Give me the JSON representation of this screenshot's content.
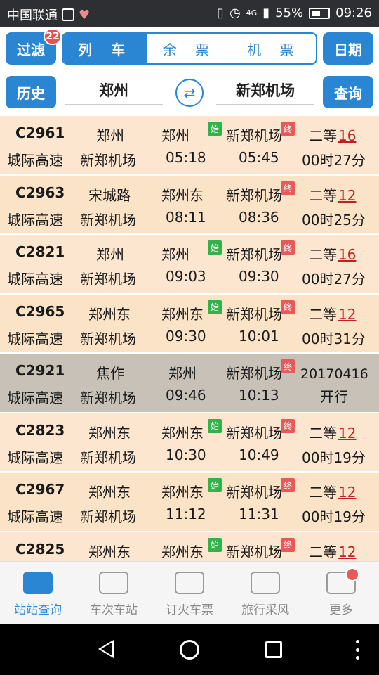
{
  "status": {
    "carrier": "中国联通",
    "network": "4G",
    "battery": "55%",
    "time": "09:26"
  },
  "toolbar": {
    "filter_label": "过滤",
    "filter_badge": "22",
    "tabs": [
      {
        "label": "列 车",
        "active": true
      },
      {
        "label": "余 票",
        "active": false
      },
      {
        "label": "机 票",
        "active": false
      }
    ],
    "date_label": "日期",
    "history_label": "历史",
    "from_station": "郑州",
    "to_station": "新郑机场",
    "query_label": "查询"
  },
  "trains": [
    {
      "code": "C2961",
      "type": "城际高速",
      "from": "郑州",
      "to": "新郑机场",
      "dep_station": "郑州",
      "dep_time": "05:18",
      "arr_station": "新郑机场",
      "arr_time": "05:45",
      "seat_class": "二等",
      "seat_count": "16",
      "duration": "00时27分",
      "start_tag": "始",
      "end_tag": "终"
    },
    {
      "code": "C2963",
      "type": "城际高速",
      "from": "宋城路",
      "to": "新郑机场",
      "dep_station": "郑州东",
      "dep_time": "08:11",
      "arr_station": "新郑机场",
      "arr_time": "08:36",
      "seat_class": "二等",
      "seat_count": "12",
      "duration": "00时25分",
      "start_tag": "",
      "end_tag": "终"
    },
    {
      "code": "C2821",
      "type": "城际高速",
      "from": "郑州",
      "to": "新郑机场",
      "dep_station": "郑州",
      "dep_time": "09:03",
      "arr_station": "新郑机场",
      "arr_time": "09:30",
      "seat_class": "二等",
      "seat_count": "16",
      "duration": "00时27分",
      "start_tag": "始",
      "end_tag": "终"
    },
    {
      "code": "C2965",
      "type": "城际高速",
      "from": "郑州东",
      "to": "新郑机场",
      "dep_station": "郑州东",
      "dep_time": "09:30",
      "arr_station": "新郑机场",
      "arr_time": "10:01",
      "seat_class": "二等",
      "seat_count": "12",
      "duration": "00时31分",
      "start_tag": "始",
      "end_tag": "终"
    },
    {
      "code": "C2921",
      "type": "城际高速",
      "from": "焦作",
      "to": "新郑机场",
      "dep_station": "郑州",
      "dep_time": "09:46",
      "arr_station": "新郑机场",
      "arr_time": "10:13",
      "notice_date": "20170416",
      "notice_text": "开行",
      "start_tag": "",
      "end_tag": "终"
    },
    {
      "code": "C2823",
      "type": "城际高速",
      "from": "郑州东",
      "to": "新郑机场",
      "dep_station": "郑州东",
      "dep_time": "10:30",
      "arr_station": "新郑机场",
      "arr_time": "10:49",
      "seat_class": "二等",
      "seat_count": "12",
      "duration": "00时19分",
      "start_tag": "始",
      "end_tag": "终"
    },
    {
      "code": "C2967",
      "type": "城际高速",
      "from": "郑州东",
      "to": "新郑机场",
      "dep_station": "郑州东",
      "dep_time": "11:12",
      "arr_station": "新郑机场",
      "arr_time": "11:31",
      "seat_class": "二等",
      "seat_count": "12",
      "duration": "00时19分",
      "start_tag": "始",
      "end_tag": "终"
    },
    {
      "code": "C2825",
      "type": "",
      "from": "郑州东",
      "to": "",
      "dep_station": "郑州东",
      "dep_time": "",
      "arr_station": "新郑机场",
      "arr_time": "",
      "seat_class": "二等",
      "seat_count": "12",
      "duration": "",
      "start_tag": "始",
      "end_tag": "终"
    }
  ],
  "bottom_nav": [
    {
      "label": "站站查询",
      "icon": "train-icon",
      "active": true
    },
    {
      "label": "车次车站",
      "icon": "briefcase-icon",
      "active": false
    },
    {
      "label": "订火车票",
      "icon": "ticket-icon",
      "active": false
    },
    {
      "label": "旅行采风",
      "icon": "chat-icon",
      "active": false
    },
    {
      "label": "更多",
      "icon": "grid-icon",
      "active": false
    }
  ],
  "colors": {
    "accent": "#2a85d3",
    "row_bg": "#fde6cf",
    "highlight_row": "#c8c1b8",
    "start_tag": "#33b24a",
    "end_tag": "#e85a5a",
    "seat_count": "#c02020"
  }
}
